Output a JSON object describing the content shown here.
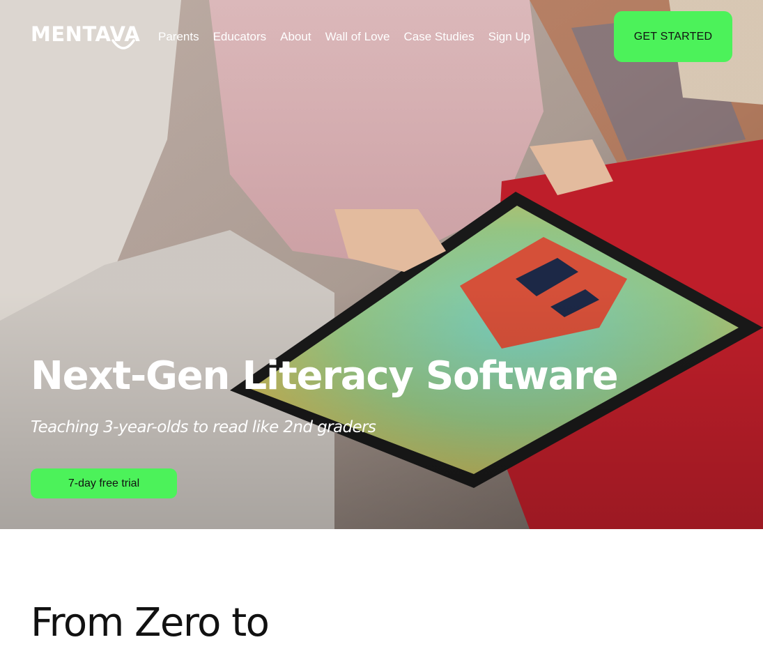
{
  "brand": {
    "logo_text": "MENTAVA",
    "accent_color": "#4cf25a"
  },
  "nav": {
    "items": [
      {
        "label": "Parents"
      },
      {
        "label": "Educators"
      },
      {
        "label": "About"
      },
      {
        "label": "Wall of Love"
      },
      {
        "label": "Case Studies"
      },
      {
        "label": "Sign Up"
      }
    ],
    "cta_label": "GET STARTED"
  },
  "hero": {
    "title": "Next-Gen Literacy Software",
    "subtitle": "Teaching 3-year-olds to read like 2nd graders",
    "cta_label": "7-day free trial",
    "background_image": "child-using-tablet-photo"
  },
  "section": {
    "heading": "From Zero to"
  }
}
